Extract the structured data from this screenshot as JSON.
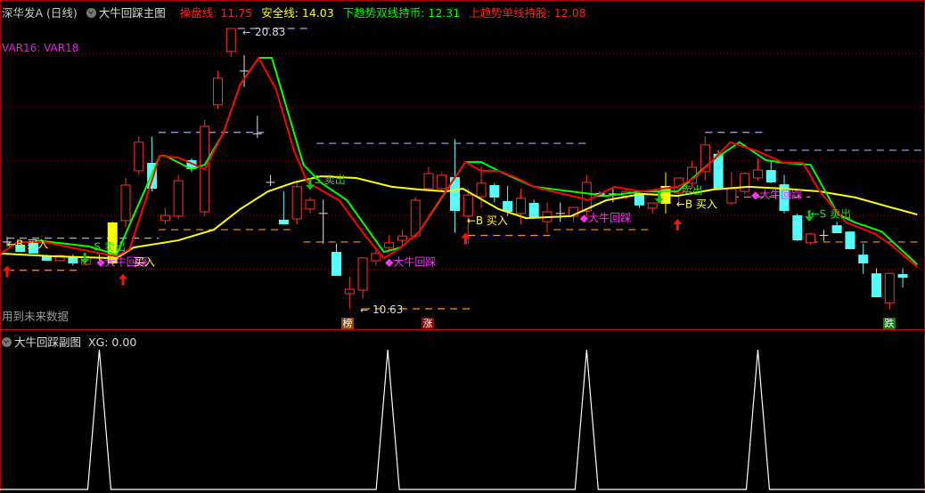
{
  "header": {
    "symbol": "深华发A (日线)",
    "indicator": "大牛回踩主图",
    "line1": "操盘线: 11.75",
    "line2": "安全线: 14.03",
    "line3": "下趋势双线持币: 12.31",
    "line4": "上趋势单线持股: 12.08"
  },
  "var_label": "VAR16: VAR18",
  "future_note": "用到未来数据",
  "sub_header": {
    "indicator": "大牛回踩副图",
    "xg": "XG: 0.00"
  },
  "badges": [
    {
      "text": "榜",
      "color": "#8b4a10"
    },
    {
      "text": "涨",
      "color": "#8b0000"
    },
    {
      "text": "跌",
      "color": "#1a7a1a"
    }
  ],
  "colors": {
    "up": "#ff3030",
    "down": "#54fcfc",
    "doji": "#e0e0e0",
    "highlight": "#ffff00",
    "operate_line": "#ff0000",
    "safe_line": "#ffff00",
    "down_trend_line": "#00ff00",
    "signal_magenta": "#ff30ff",
    "grid": "#a00000"
  },
  "chart_data": {
    "type": "candlestick",
    "price_labels": {
      "high": "20.83",
      "low": "10.63"
    },
    "high": 20.83,
    "low": 10.63,
    "candles": [
      [
        13.06,
        13.25,
        12.9,
        13.06
      ],
      [
        12.96,
        13.0,
        12.7,
        12.7
      ],
      [
        13.06,
        13.1,
        12.64,
        12.64
      ],
      [
        12.57,
        12.6,
        12.38,
        12.38
      ],
      [
        12.38,
        12.6,
        12.35,
        12.57
      ],
      [
        12.54,
        12.6,
        12.2,
        12.28
      ],
      [
        12.25,
        12.55,
        12.2,
        12.51
      ],
      [
        12.48,
        12.6,
        12.3,
        12.48
      ],
      [
        12.28,
        13.8,
        12.2,
        13.77
      ],
      [
        13.84,
        15.4,
        13.6,
        15.13
      ],
      [
        15.65,
        16.9,
        15.5,
        16.69
      ],
      [
        15.94,
        16.9,
        14.9,
        15.0
      ],
      [
        13.84,
        14.3,
        13.7,
        14.03
      ],
      [
        14.0,
        15.5,
        13.9,
        15.29
      ],
      [
        16.04,
        16.1,
        15.6,
        15.71
      ],
      [
        14.16,
        17.5,
        14.0,
        17.27
      ],
      [
        18.05,
        19.3,
        17.9,
        19.02
      ],
      [
        19.99,
        20.83,
        19.8,
        20.83
      ],
      [
        19.28,
        19.86,
        18.7,
        19.28
      ],
      [
        17.0,
        17.65,
        16.85,
        17.0
      ],
      [
        15.23,
        15.5,
        15.1,
        15.23
      ],
      [
        13.87,
        14.9,
        13.7,
        13.7
      ],
      [
        13.9,
        15.3,
        13.7,
        15.07
      ],
      [
        14.26,
        14.7,
        14.1,
        14.58
      ],
      [
        14.1,
        14.6,
        13.0,
        14.1
      ],
      [
        12.7,
        13.0,
        11.83,
        11.83
      ],
      [
        11.18,
        11.8,
        10.63,
        11.34
      ],
      [
        11.31,
        12.5,
        11.0,
        12.48
      ],
      [
        12.38,
        12.9,
        12.2,
        12.64
      ],
      [
        12.86,
        13.3,
        12.7,
        13.03
      ],
      [
        13.12,
        13.5,
        12.9,
        13.28
      ],
      [
        13.28,
        14.7,
        13.2,
        14.58
      ],
      [
        15.0,
        15.8,
        14.9,
        15.55
      ],
      [
        15.0,
        15.6,
        14.9,
        15.49
      ],
      [
        15.42,
        16.8,
        13.4,
        14.19
      ],
      [
        14.0,
        15.0,
        13.0,
        14.77
      ],
      [
        14.71,
        15.8,
        14.3,
        15.2
      ],
      [
        15.13,
        15.2,
        14.5,
        14.68
      ],
      [
        14.55,
        15.1,
        14.0,
        14.16
      ],
      [
        14.1,
        15.0,
        13.7,
        14.65
      ],
      [
        14.48,
        14.6,
        13.9,
        13.93
      ],
      [
        13.8,
        14.5,
        13.4,
        14.16
      ],
      [
        14.1,
        14.5,
        13.8,
        14.1
      ],
      [
        14.0,
        14.3,
        13.8,
        14.32
      ],
      [
        14.19,
        15.5,
        14.0,
        15.23
      ],
      [
        14.84,
        14.9,
        14.7,
        14.71
      ],
      [
        14.81,
        15.0,
        14.5,
        14.81
      ],
      [
        14.74,
        14.95,
        14.6,
        14.9
      ],
      [
        14.84,
        14.9,
        14.3,
        14.39
      ],
      [
        14.29,
        14.5,
        14.1,
        14.48
      ],
      [
        14.45,
        15.6,
        14.1,
        15.1
      ],
      [
        14.84,
        15.3,
        14.5,
        15.39
      ],
      [
        15.2,
        16.0,
        15.0,
        15.78
      ],
      [
        15.62,
        16.9,
        15.3,
        16.59
      ],
      [
        16.27,
        16.4,
        14.97,
        14.97
      ],
      [
        14.48,
        15.6,
        14.4,
        15.0
      ],
      [
        14.9,
        15.6,
        14.8,
        15.55
      ],
      [
        15.39,
        16.1,
        15.3,
        15.68
      ],
      [
        15.68,
        16.0,
        15.2,
        15.23
      ],
      [
        15.16,
        15.5,
        14.1,
        14.19
      ],
      [
        14.03,
        14.1,
        13.1,
        13.12
      ],
      [
        13.03,
        13.4,
        12.95,
        13.35
      ],
      [
        13.3,
        13.5,
        13.1,
        13.3
      ],
      [
        13.67,
        13.8,
        13.38,
        13.38
      ],
      [
        13.44,
        13.45,
        12.8,
        12.8
      ],
      [
        12.6,
        13.0,
        11.9,
        12.28
      ],
      [
        11.92,
        12.1,
        11.05,
        11.05
      ],
      [
        10.85,
        11.93,
        10.6,
        11.92
      ],
      [
        11.89,
        12.1,
        11.4,
        11.76
      ]
    ],
    "highlight_candles": [
      8,
      50
    ],
    "series": [
      {
        "key": "safe",
        "points": [
          [
            -0.5,
            12.64
          ],
          [
            3.5,
            12.54
          ],
          [
            8.3,
            12.47
          ],
          [
            9.6,
            12.86
          ],
          [
            13,
            13.12
          ],
          [
            15.7,
            13.51
          ],
          [
            17.7,
            14.26
          ],
          [
            19.8,
            14.9
          ],
          [
            21.8,
            15.23
          ],
          [
            23.8,
            15.45
          ],
          [
            26.5,
            15.39
          ],
          [
            29.2,
            15.07
          ],
          [
            31.3,
            14.97
          ],
          [
            33.3,
            14.9
          ],
          [
            34.6,
            15.0
          ],
          [
            37.3,
            14.26
          ],
          [
            39.4,
            13.93
          ],
          [
            42.8,
            14.0
          ],
          [
            45.5,
            14.58
          ],
          [
            48.2,
            14.81
          ],
          [
            50.9,
            14.74
          ],
          [
            53.6,
            14.97
          ],
          [
            56.3,
            15.07
          ],
          [
            59,
            15.0
          ],
          [
            61.7,
            14.9
          ],
          [
            64.4,
            14.68
          ],
          [
            67.1,
            14.32
          ],
          [
            69.1,
            14.06
          ]
        ]
      },
      {
        "key": "down_trend",
        "points": [
          [
            2.2,
            13.12
          ],
          [
            6.2,
            12.9
          ],
          [
            8.3,
            12.6
          ],
          [
            11.6,
            16.2
          ],
          [
            12,
            16.2
          ],
          [
            14,
            15.71
          ],
          [
            15,
            15.87
          ],
          [
            16.4,
            17.01
          ],
          [
            17.7,
            18.79
          ],
          [
            19.1,
            19.76
          ],
          [
            20.1,
            19.76
          ],
          [
            22.5,
            15.87
          ],
          [
            23.8,
            15.23
          ],
          [
            25.8,
            14.58
          ],
          [
            28.6,
            12.7
          ],
          [
            29.9,
            12.86
          ],
          [
            31.3,
            13.44
          ],
          [
            34.8,
            15.97
          ],
          [
            36,
            15.97
          ],
          [
            37.3,
            15.65
          ],
          [
            40,
            15.07
          ],
          [
            42.8,
            14.9
          ],
          [
            45.5,
            14.74
          ],
          [
            48.2,
            14.9
          ],
          [
            50.9,
            14.9
          ],
          [
            53.6,
            16.04
          ],
          [
            55.6,
            16.69
          ],
          [
            57.6,
            16.04
          ],
          [
            59,
            15.94
          ],
          [
            61,
            15.87
          ],
          [
            63.1,
            14.06
          ],
          [
            64.4,
            13.77
          ],
          [
            66.4,
            13.44
          ],
          [
            69.1,
            12.24
          ]
        ]
      },
      {
        "key": "operate",
        "points": [
          [
            -0.5,
            12.64
          ],
          [
            0.8,
            13.06
          ],
          [
            2.8,
            13.06
          ],
          [
            6.2,
            12.73
          ],
          [
            8.3,
            12.54
          ],
          [
            9.3,
            12.8
          ],
          [
            11.6,
            16.2
          ],
          [
            13,
            16.13
          ],
          [
            15,
            15.71
          ],
          [
            16.4,
            17.01
          ],
          [
            17.7,
            18.79
          ],
          [
            19.1,
            19.76
          ],
          [
            20.4,
            18.63
          ],
          [
            21.8,
            16.36
          ],
          [
            22.8,
            15.23
          ],
          [
            25.2,
            14.58
          ],
          [
            27.2,
            13.28
          ],
          [
            28.6,
            12.47
          ],
          [
            29.9,
            12.86
          ],
          [
            31.3,
            13.44
          ],
          [
            32.6,
            14.42
          ],
          [
            34.8,
            15.97
          ],
          [
            36,
            15.65
          ],
          [
            37.3,
            15.65
          ],
          [
            38.7,
            15.39
          ],
          [
            40,
            15.07
          ],
          [
            41.4,
            14.9
          ],
          [
            43.4,
            14.68
          ],
          [
            44.1,
            14.58
          ],
          [
            46.1,
            15.07
          ],
          [
            48.2,
            14.9
          ],
          [
            50.9,
            15.07
          ],
          [
            52.2,
            15.39
          ],
          [
            53.6,
            16.04
          ],
          [
            54.9,
            16.69
          ],
          [
            57,
            16.36
          ],
          [
            59,
            15.94
          ],
          [
            60.4,
            15.94
          ],
          [
            61.7,
            14.9
          ],
          [
            63.7,
            13.77
          ],
          [
            65.8,
            13.38
          ],
          [
            67.1,
            12.96
          ],
          [
            69.1,
            12.15
          ]
        ]
      }
    ],
    "levels": [
      {
        "price": 20.83,
        "from": 17.5,
        "to": 23,
        "kind": "resistance"
      },
      {
        "price": 17.05,
        "from": 11.5,
        "to": 19.5,
        "kind": "resistance"
      },
      {
        "price": 16.65,
        "from": 23.5,
        "to": 44,
        "kind": "resistance"
      },
      {
        "price": 17.05,
        "from": 53,
        "to": 57.5,
        "kind": "resistance"
      },
      {
        "price": 16.4,
        "from": 57.5,
        "to": 69.5,
        "kind": "resistance"
      },
      {
        "price": 13.2,
        "from": 0,
        "to": 11.5,
        "kind": "resistance"
      },
      {
        "price": 12.03,
        "from": 0,
        "to": 5.5,
        "kind": "support"
      },
      {
        "price": 13.51,
        "from": 11.5,
        "to": 21.5,
        "kind": "support"
      },
      {
        "price": 13.06,
        "from": 22.5,
        "to": 27,
        "kind": "support"
      },
      {
        "price": 10.63,
        "from": 27,
        "to": 35.5,
        "kind": "support"
      },
      {
        "price": 13.3,
        "from": 35,
        "to": 41.5,
        "kind": "support"
      },
      {
        "price": 13.51,
        "from": 41.5,
        "to": 49,
        "kind": "support"
      },
      {
        "price": 14.7,
        "from": 55,
        "to": 61,
        "kind": "support"
      },
      {
        "price": 13.06,
        "from": 61,
        "to": 69.5,
        "kind": "support"
      }
    ],
    "arrows": [
      {
        "i": 0,
        "price": 12.2,
        "dir": "up"
      },
      {
        "i": 8.8,
        "price": 11.9,
        "dir": "up"
      },
      {
        "i": 34.8,
        "price": 13.4,
        "dir": "up"
      },
      {
        "i": 50.9,
        "price": 13.9,
        "dir": "up"
      },
      {
        "i": 5.9,
        "price": 12.25,
        "dir": "down"
      },
      {
        "i": 23,
        "price": 14.95,
        "dir": "down"
      },
      {
        "i": 49.5,
        "price": 14.45,
        "dir": "down"
      },
      {
        "i": 60.9,
        "price": 13.8,
        "dir": "down"
      }
    ],
    "signals": [
      {
        "i": 0,
        "price": 12.85,
        "text": "←B 买入",
        "kind": "buy"
      },
      {
        "i": 6.6,
        "price": 12.75,
        "text": "S 卖出",
        "kind": "sell"
      },
      {
        "i": 6.8,
        "price": 12.2,
        "text": "◆大牛回踩",
        "kind": "pullback"
      },
      {
        "i": 9.6,
        "price": 12.2,
        "text": "买入",
        "kind": "buy"
      },
      {
        "i": 23.3,
        "price": 15.2,
        "text": "S 卖出",
        "kind": "sell"
      },
      {
        "i": 28.7,
        "price": 12.2,
        "text": "◆大牛回踩",
        "kind": "pullback"
      },
      {
        "i": 34.9,
        "price": 13.7,
        "text": "←B 买入",
        "kind": "buy"
      },
      {
        "i": 43.5,
        "price": 13.8,
        "text": "◆大牛回踩",
        "kind": "pullback"
      },
      {
        "i": 51.2,
        "price": 14.8,
        "text": "卖出",
        "kind": "sell"
      },
      {
        "i": 50.8,
        "price": 14.3,
        "text": "←B 买入",
        "kind": "buy"
      },
      {
        "i": 56.5,
        "price": 14.65,
        "text": "◆大牛回踩",
        "kind": "pullback"
      },
      {
        "i": 61.0,
        "price": 13.95,
        "text": "←S 卖出",
        "kind": "sell"
      }
    ],
    "xg_signals": [
      7.0,
      28.9,
      44.0,
      57.0
    ],
    "xg_range": [
      0,
      1
    ]
  }
}
